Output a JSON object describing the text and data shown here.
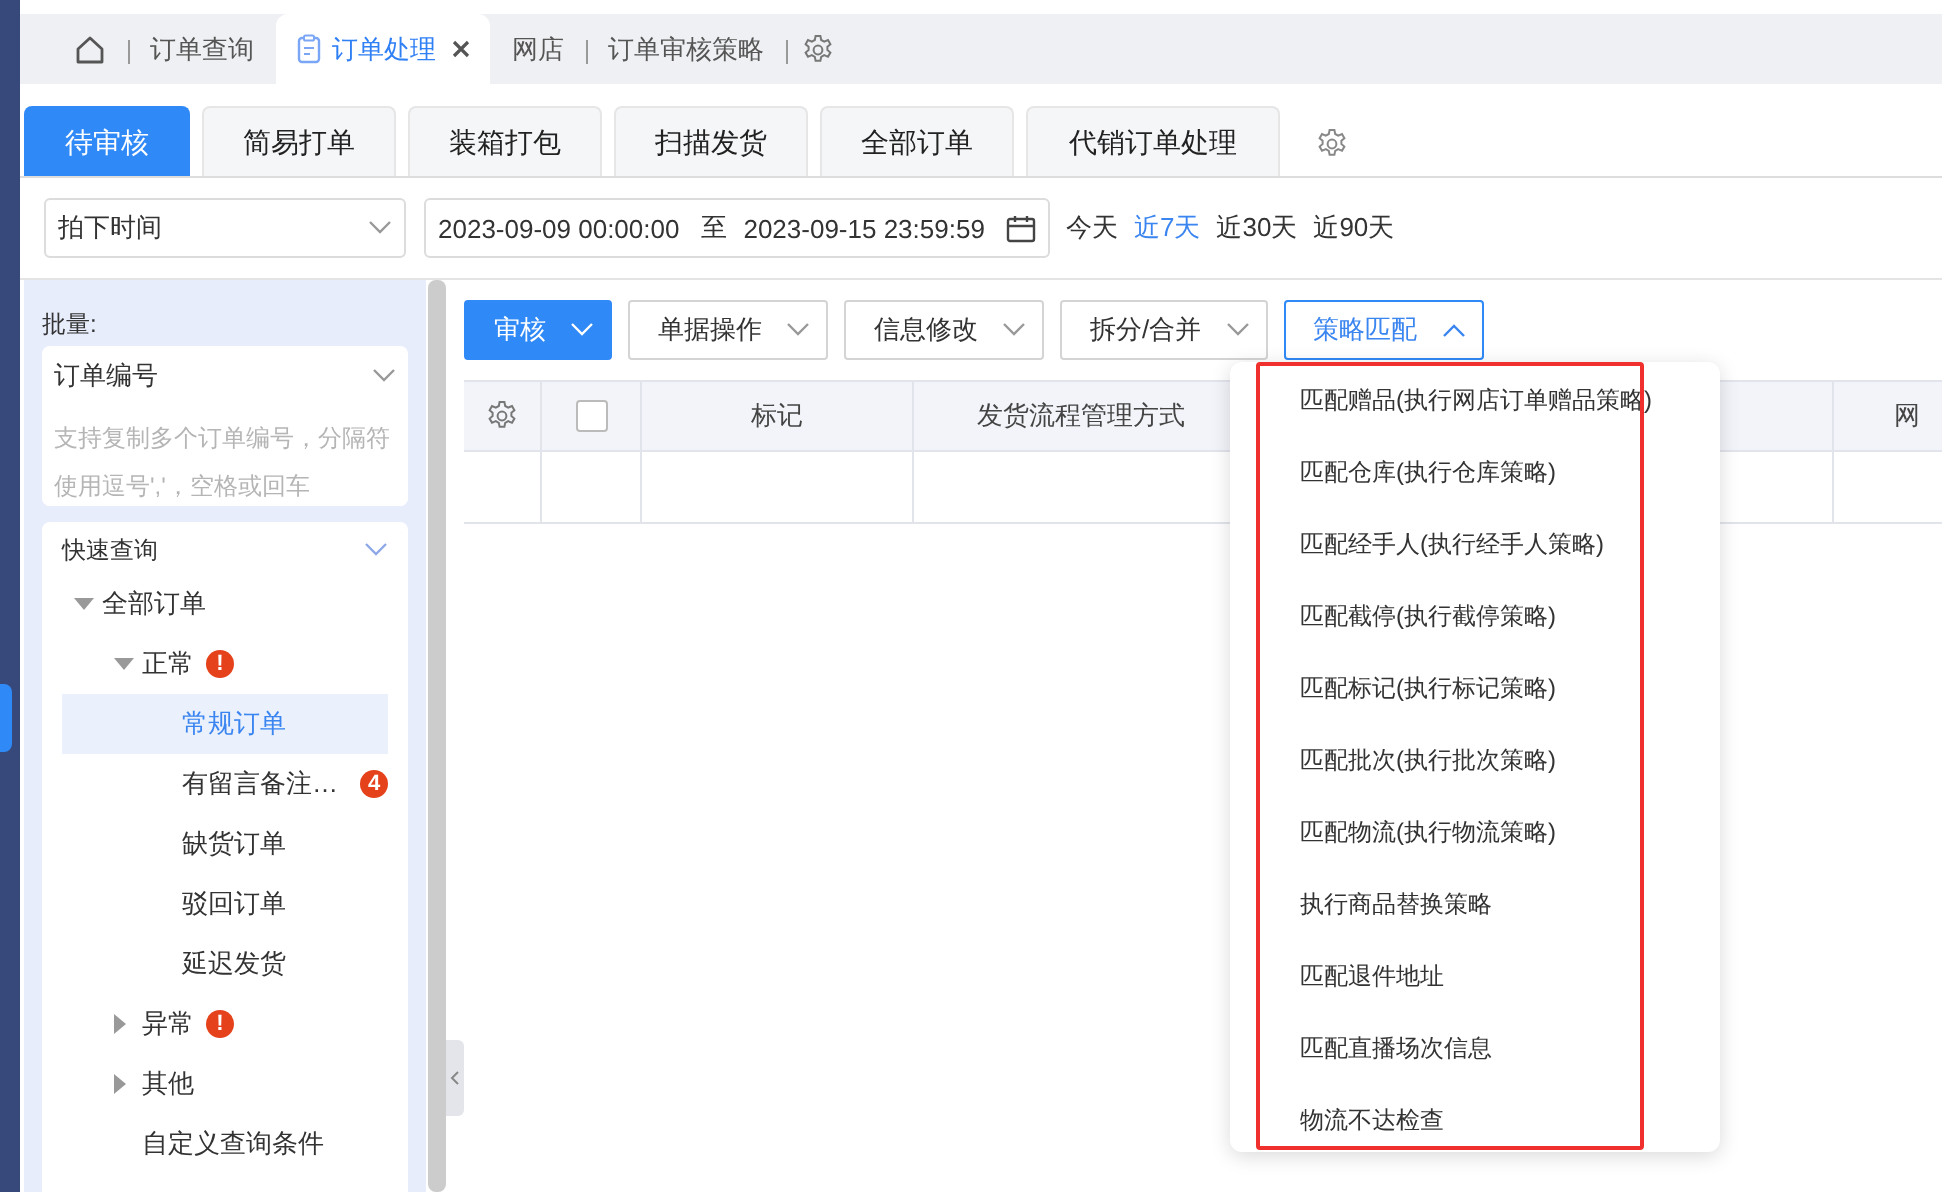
{
  "top_tabs": [
    {
      "kind": "home",
      "selected": false,
      "closable": false
    },
    {
      "kind": "text",
      "label": "订单查询",
      "selected": false,
      "closable": false
    },
    {
      "kind": "text",
      "label": "订单处理",
      "selected": true,
      "closable": true
    },
    {
      "kind": "text",
      "label": "网店",
      "selected": false,
      "closable": false
    },
    {
      "kind": "text",
      "label": "订单审核策略",
      "selected": false,
      "closable": false
    }
  ],
  "sub_tabs": [
    {
      "label": "待审核",
      "selected": true
    },
    {
      "label": "简易打单",
      "selected": false
    },
    {
      "label": "装箱打包",
      "selected": false
    },
    {
      "label": "扫描发货",
      "selected": false
    },
    {
      "label": "全部订单",
      "selected": false
    },
    {
      "label": "代销订单处理",
      "selected": false
    }
  ],
  "filter": {
    "time_field": "拍下时间",
    "date_from": "2023-09-09 00:00:00",
    "date_sep": "至",
    "date_to": "2023-09-15 23:59:59",
    "quick_ranges": [
      {
        "label": "今天",
        "selected": false
      },
      {
        "label": "近7天",
        "selected": true
      },
      {
        "label": "近30天",
        "selected": false
      },
      {
        "label": "近90天",
        "selected": false
      }
    ]
  },
  "sidebar": {
    "batch_label": "批量:",
    "batch_field": {
      "label": "订单编号",
      "placeholder": "支持复制多个订单编号，分隔符使用逗号','，空格或回车"
    },
    "quick_query": {
      "title": "快速查询",
      "expanded": true,
      "tree": [
        {
          "label": "全部订单",
          "expanded": true,
          "selected": false,
          "children": [
            {
              "label": "正常",
              "expanded": true,
              "selected": false,
              "badge": {
                "kind": "alert",
                "text": "!"
              },
              "children": [
                {
                  "label": "常规订单",
                  "selected": true
                },
                {
                  "label": "有留言备注…",
                  "selected": false,
                  "badge": {
                    "kind": "count",
                    "text": "4"
                  }
                },
                {
                  "label": "缺货订单",
                  "selected": false
                },
                {
                  "label": "驳回订单",
                  "selected": false
                },
                {
                  "label": "延迟发货",
                  "selected": false
                }
              ]
            },
            {
              "label": "异常",
              "expanded": false,
              "selected": false,
              "badge": {
                "kind": "alert",
                "text": "!"
              }
            },
            {
              "label": "其他",
              "expanded": false,
              "selected": false
            },
            {
              "label": "自定义查询条件",
              "selected": false
            }
          ]
        }
      ]
    }
  },
  "actions": [
    {
      "label": "审核",
      "kind": "primary",
      "open": false
    },
    {
      "label": "单据操作",
      "kind": "default",
      "open": false
    },
    {
      "label": "信息修改",
      "kind": "default",
      "open": false
    },
    {
      "label": "拆分/合并",
      "kind": "default",
      "open": false
    },
    {
      "label": "策略匹配",
      "kind": "default",
      "open": true
    }
  ],
  "table": {
    "columns": [
      {
        "kind": "settings"
      },
      {
        "kind": "checkbox",
        "checked": false
      },
      {
        "kind": "text",
        "label": "标记"
      },
      {
        "kind": "text",
        "label": "发货流程管理方式"
      },
      {
        "kind": "blank"
      },
      {
        "kind": "text",
        "label": "网"
      }
    ]
  },
  "strategy_menu": {
    "highlighted": true,
    "items": [
      "匹配赠品(执行网店订单赠品策略)",
      "匹配仓库(执行仓库策略)",
      "匹配经手人(执行经手人策略)",
      "匹配截停(执行截停策略)",
      "匹配标记(执行标记策略)",
      "匹配批次(执行批次策略)",
      "匹配物流(执行物流策略)",
      "执行商品替换策略",
      "匹配退件地址",
      "匹配直播场次信息",
      "物流不达检查"
    ]
  }
}
